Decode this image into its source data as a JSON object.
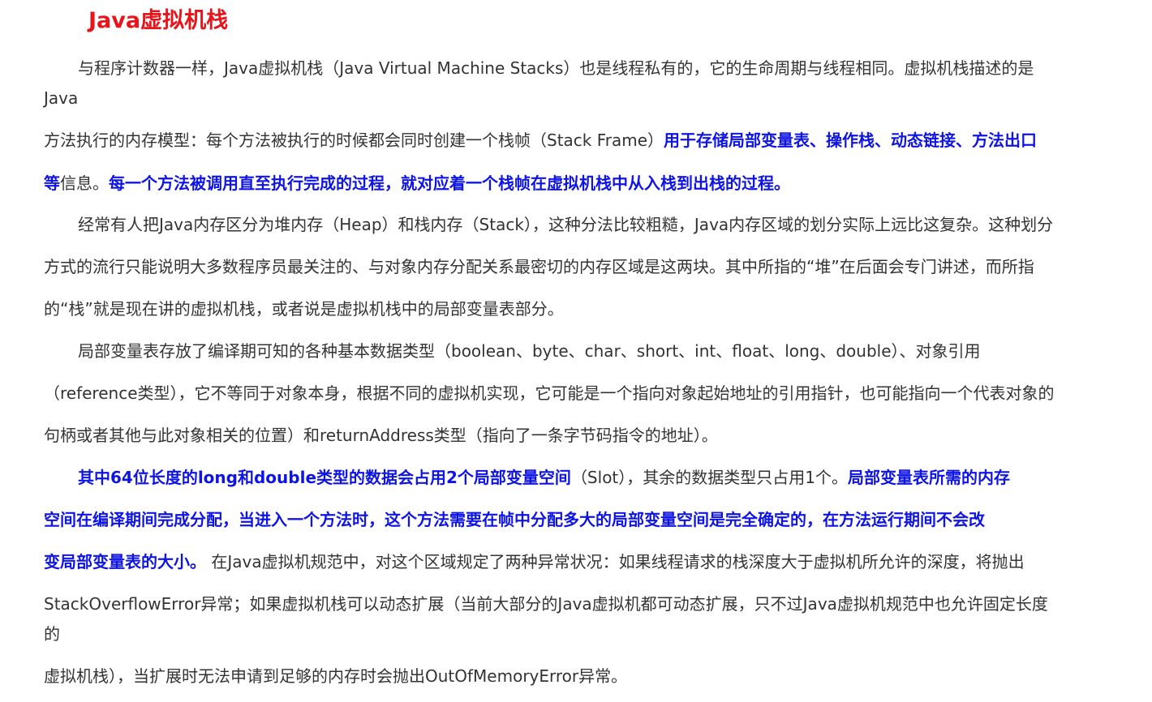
{
  "title": "Java虚拟机栈",
  "lines": [
    {
      "segments": [
        {
          "text": "与程序计数器一样，Java虚拟机栈（Java Virtual Machine Stacks）也是线程私有的，它的生命周期与线程相同。虚拟机栈描述的是"
        }
      ]
    },
    {
      "segments": [
        {
          "text": "Java"
        }
      ]
    },
    {
      "segments": [
        {
          "text": "方法执行的内存模型：每个方法被执行的时候都会同时创建一个栈帧（Stack Frame）"
        },
        {
          "text": "用于存储局部变量表、操作栈、动态链接、方法出口"
        }
      ]
    },
    {
      "segments": [
        {
          "text": "等"
        },
        {
          "text": "信息。"
        },
        {
          "text": "每一个方法被调用直至执行完成的过程，就对应着一个栈帧在虚拟机栈中从入栈到出栈的过程。"
        }
      ]
    },
    {
      "segments": [
        {
          "text": "经常有人把Java内存区分为堆内存（Heap）和栈内存（Stack），这种分法比较粗糙，Java内存区域的划分实际上远比这复杂。这种划分"
        }
      ]
    },
    {
      "segments": [
        {
          "text": "方式的流行只能说明大多数程序员最关注的、与对象内存分配关系最密切的内存区域是这两块。其中所指的“堆”在后面会专门讲述，而所指"
        }
      ]
    },
    {
      "segments": [
        {
          "text": "的“栈”就是现在讲的虚拟机栈，或者说是虚拟机栈中的局部变量表部分。"
        }
      ]
    },
    {
      "segments": [
        {
          "text": "局部变量表存放了编译期可知的各种基本数据类型（boolean、byte、char、short、int、float、long、double）、对象引用"
        }
      ]
    },
    {
      "segments": [
        {
          "text": "（reference类型），它不等同于对象本身，根据不同的虚拟机实现，它可能是一个指向对象起始地址的引用指针，也可能指向一个代表对象的"
        }
      ]
    },
    {
      "segments": [
        {
          "text": "句柄或者其他与此对象相关的位置）和returnAddress类型（指向了一条字节码指令的地址）。"
        }
      ]
    },
    {
      "segments": [
        {
          "text": "其中64位长度的long和double类型的数据会占用2个局部变量空间"
        },
        {
          "text": "（Slot），其余的数据类型只占用1个。"
        },
        {
          "text": "局部变量表所需的内存"
        }
      ]
    },
    {
      "segments": [
        {
          "text": "空间在编译期间完成分配，当进入一个方法时，这个方法需要在帧中分配多大的局部变量空间是完全确定的，在方法运行期间不会改"
        }
      ]
    },
    {
      "segments": [
        {
          "text": "变局部变量表的大小。"
        },
        {
          "text": " 在Java虚拟机规范中，对这个区域规定了两种异常状况：如果线程请求的栈深度大于虚拟机所允许的深度，将抛出"
        }
      ]
    },
    {
      "segments": [
        {
          "text": "StackOverflowError异常；如果虚拟机栈可以动态扩展（当前大部分的Java虚拟机都可动态扩展，只不过Java虚拟机规范中也允许固定长度"
        }
      ]
    },
    {
      "segments": [
        {
          "text": "的"
        }
      ]
    },
    {
      "segments": [
        {
          "text": "虚拟机栈），当扩展时无法申请到足够的内存时会抛出OutOfMemoryError异常。"
        }
      ]
    }
  ],
  "colors": {
    "title": "#e8141b",
    "text": "#333333",
    "highlight": "#0f14e6"
  }
}
